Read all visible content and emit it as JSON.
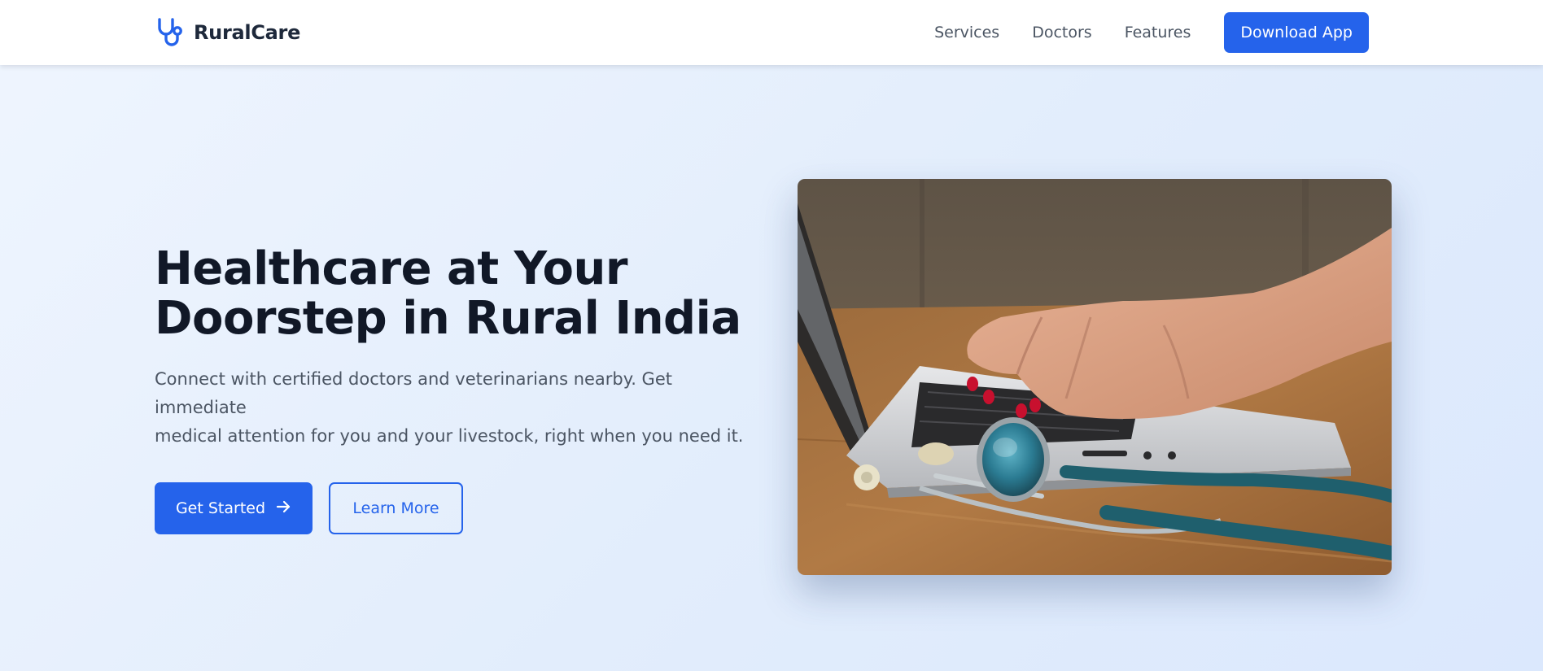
{
  "brand": {
    "name": "RuralCare",
    "logo_icon": "stethoscope-icon",
    "accent_color": "#2563eb"
  },
  "nav": {
    "links": [
      "Services",
      "Doctors",
      "Features"
    ],
    "download_label": "Download App"
  },
  "hero": {
    "title_line1": "Healthcare at Your",
    "title_line2": "Doorstep in Rural India",
    "description_line1": "Connect with certified doctors and veterinarians nearby. Get immediate",
    "description_line2": "medical attention for you and your livestock, right when you need it.",
    "primary_label": "Get Started",
    "primary_icon": "arrow-right-icon",
    "secondary_label": "Learn More",
    "image_subject": "hands-typing-on-laptop-with-stethoscope-photo"
  }
}
